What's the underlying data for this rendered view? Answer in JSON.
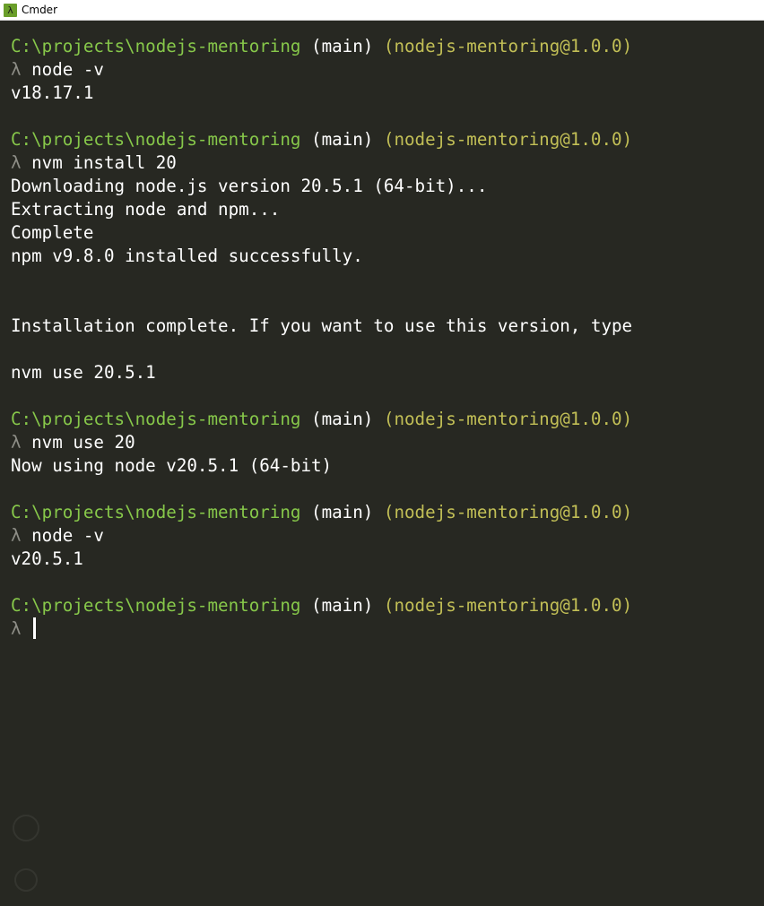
{
  "window": {
    "title": "Cmder",
    "icon": "lambda-icon"
  },
  "prompt": {
    "path": "C:\\projects\\nodejs-mentoring",
    "branch": "(main)",
    "package": "(nodejs-mentoring@1.0.0)",
    "symbol": "λ"
  },
  "session": [
    {
      "type": "prompt"
    },
    {
      "type": "command",
      "text": "node -v"
    },
    {
      "type": "output",
      "text": "v18.17.1"
    },
    {
      "type": "blank"
    },
    {
      "type": "prompt"
    },
    {
      "type": "command",
      "text": "nvm install 20"
    },
    {
      "type": "output",
      "text": "Downloading node.js version 20.5.1 (64-bit)..."
    },
    {
      "type": "output",
      "text": "Extracting node and npm..."
    },
    {
      "type": "output",
      "text": "Complete"
    },
    {
      "type": "output",
      "text": "npm v9.8.0 installed successfully."
    },
    {
      "type": "blank"
    },
    {
      "type": "blank"
    },
    {
      "type": "output",
      "text": "Installation complete. If you want to use this version, type"
    },
    {
      "type": "blank"
    },
    {
      "type": "output",
      "text": "nvm use 20.5.1"
    },
    {
      "type": "blank"
    },
    {
      "type": "prompt"
    },
    {
      "type": "command",
      "text": "nvm use 20"
    },
    {
      "type": "output",
      "text": "Now using node v20.5.1 (64-bit)"
    },
    {
      "type": "blank"
    },
    {
      "type": "prompt"
    },
    {
      "type": "command",
      "text": "node -v"
    },
    {
      "type": "output",
      "text": "v20.5.1"
    },
    {
      "type": "blank"
    },
    {
      "type": "prompt"
    },
    {
      "type": "input",
      "text": ""
    }
  ],
  "colors": {
    "background": "#272822",
    "path": "#87c84a",
    "package": "#c2bf56",
    "text": "#ffffff",
    "lambda": "#8d8d86"
  }
}
